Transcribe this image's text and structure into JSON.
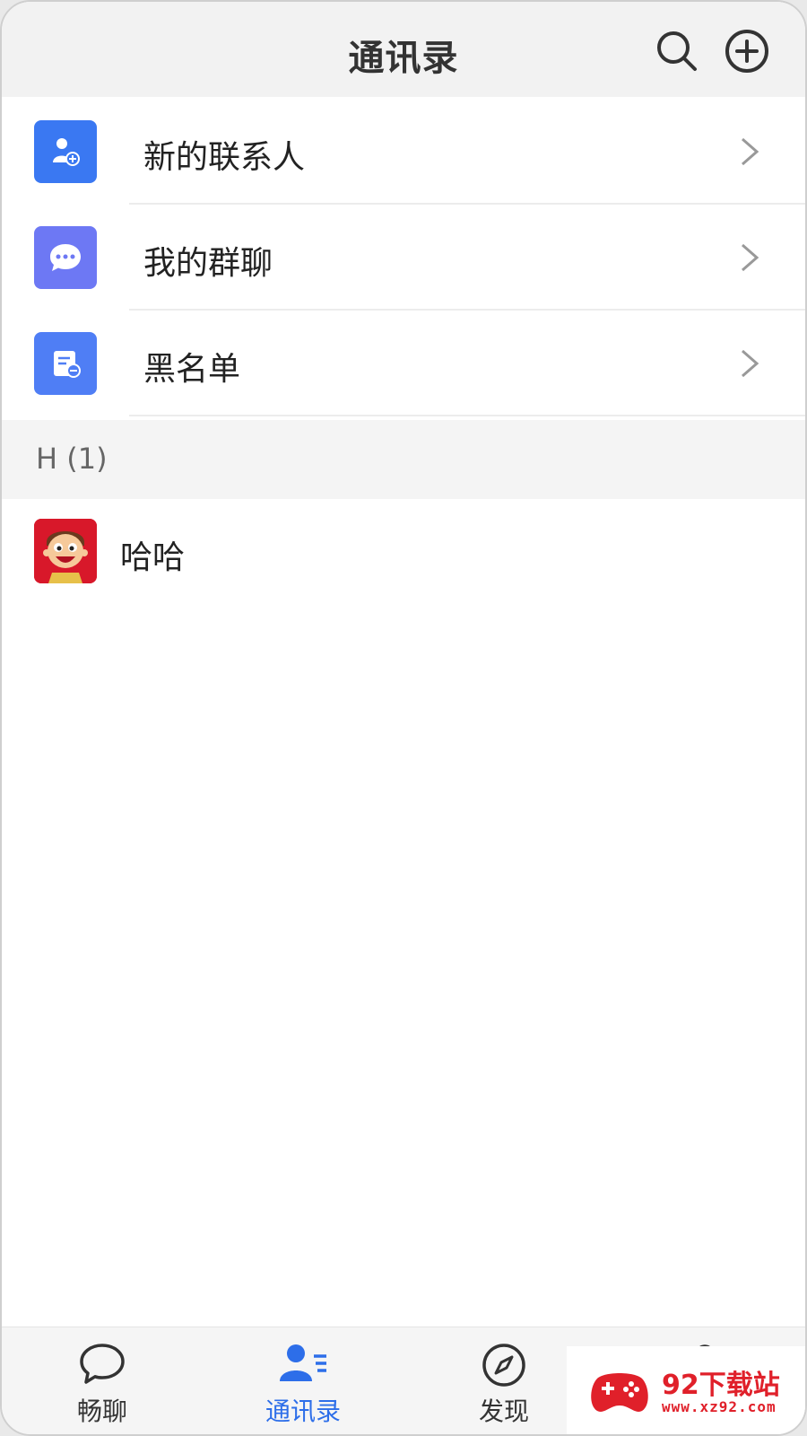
{
  "header": {
    "title": "通讯录",
    "search_icon": "search-icon",
    "add_icon": "plus-circle-icon"
  },
  "menu": [
    {
      "label": "新的联系人",
      "icon": "add-contact-icon",
      "color": "#3a78f2"
    },
    {
      "label": "我的群聊",
      "icon": "group-chat-icon",
      "color": "#6d78f4"
    },
    {
      "label": "黑名单",
      "icon": "blacklist-icon",
      "color": "#4f7ef5"
    }
  ],
  "section": {
    "title": "H (1)"
  },
  "contacts": [
    {
      "name": "哈哈",
      "avatar": "cartoon-avatar"
    }
  ],
  "tabs": [
    {
      "label": "畅聊",
      "icon": "chat-bubble-icon",
      "active": false
    },
    {
      "label": "通讯录",
      "icon": "contacts-icon",
      "active": true
    },
    {
      "label": "发现",
      "icon": "compass-icon",
      "active": false
    },
    {
      "label": "",
      "icon": "profile-icon",
      "active": false
    }
  ],
  "watermark": {
    "title": "92下载站",
    "url": "www.xz92.com"
  },
  "colors": {
    "accent": "#2d6ee9",
    "header_bg": "#f2f2f2",
    "section_bg": "#f4f4f4",
    "watermark_red": "#e0202a"
  }
}
